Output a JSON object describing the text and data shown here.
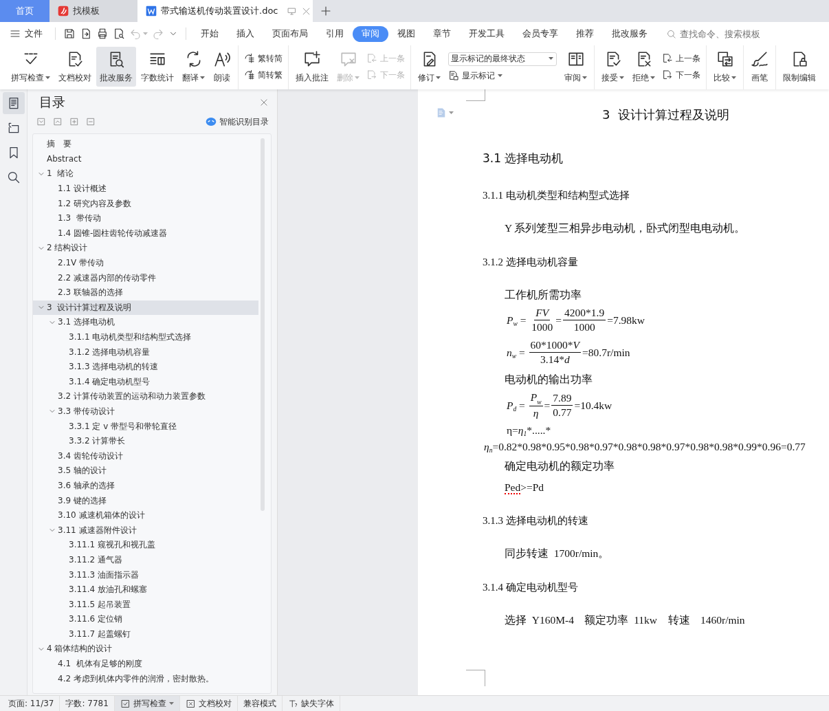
{
  "tabs": [
    {
      "label": "首页",
      "kind": "home",
      "selected": false
    },
    {
      "label": "找模板",
      "kind": "template",
      "selected": false
    },
    {
      "label": "带式输送机传动装置设计.doc",
      "kind": "document",
      "selected": true
    }
  ],
  "menu": {
    "file": "文件"
  },
  "quick_tools": [
    {
      "disabled": false,
      "dropdown": false
    },
    {
      "disabled": false,
      "dropdown": false
    },
    {
      "disabled": false,
      "dropdown": false
    },
    {
      "disabled": false,
      "dropdown": false
    },
    {
      "disabled": true,
      "dropdown": true
    },
    {
      "disabled": true,
      "dropdown": false
    }
  ],
  "ribbon_tabs": [
    {
      "label": "开始",
      "selected": false
    },
    {
      "label": "插入",
      "selected": false
    },
    {
      "label": "页面布局",
      "selected": false
    },
    {
      "label": "引用",
      "selected": false
    },
    {
      "label": "审阅",
      "selected": true
    },
    {
      "label": "视图",
      "selected": false
    },
    {
      "label": "章节",
      "selected": false
    },
    {
      "label": "开发工具",
      "selected": false
    },
    {
      "label": "会员专享",
      "selected": false
    },
    {
      "label": "推荐",
      "selected": false
    },
    {
      "label": "批改服务",
      "selected": false
    }
  ],
  "search": {
    "placeholder": "查找命令、搜索模板"
  },
  "ribbon": {
    "groups": [
      {
        "items": [
          {
            "kind": "large",
            "label": "拼写检查",
            "dropdown": true,
            "disabled": false,
            "selected": false
          },
          {
            "kind": "large",
            "label": "文档校对",
            "dropdown": false,
            "disabled": false,
            "selected": false
          },
          {
            "kind": "large",
            "label": "批改服务",
            "dropdown": false,
            "disabled": false,
            "selected": true
          },
          {
            "kind": "large",
            "label": "字数统计",
            "dropdown": false,
            "disabled": false,
            "selected": false
          },
          {
            "kind": "large",
            "label": "翻译",
            "dropdown": true,
            "disabled": false,
            "selected": false
          },
          {
            "kind": "large",
            "label": "朗读",
            "dropdown": false,
            "disabled": false,
            "selected": false
          }
        ]
      },
      {
        "items": [
          {
            "kind": "stack",
            "buttons": [
              {
                "label": "繁转简",
                "disabled": false
              },
              {
                "label": "简转繁",
                "disabled": false
              }
            ]
          }
        ]
      },
      {
        "items": [
          {
            "kind": "large",
            "label": "插入批注",
            "dropdown": false,
            "disabled": false,
            "selected": false
          },
          {
            "kind": "large",
            "label": "删除",
            "dropdown": true,
            "disabled": true,
            "selected": false
          },
          {
            "kind": "stack",
            "buttons": [
              {
                "label": "上一条",
                "disabled": true
              },
              {
                "label": "下一条",
                "disabled": true
              }
            ]
          }
        ]
      },
      {
        "items": [
          {
            "kind": "large",
            "label": "修订",
            "dropdown": true,
            "disabled": false,
            "selected": false
          },
          {
            "kind": "select",
            "value": "显示标记的最终状态",
            "button": {
              "label": "显示标记",
              "dropdown": true
            }
          },
          {
            "kind": "large",
            "label": "审阅",
            "dropdown": true,
            "disabled": false,
            "selected": false
          }
        ]
      },
      {
        "items": [
          {
            "kind": "large",
            "label": "接受",
            "dropdown": true,
            "disabled": false,
            "selected": false
          },
          {
            "kind": "large",
            "label": "拒绝",
            "dropdown": true,
            "disabled": false,
            "selected": false
          },
          {
            "kind": "stack",
            "buttons": [
              {
                "label": "上一条",
                "disabled": false
              },
              {
                "label": "下一条",
                "disabled": false
              }
            ]
          }
        ]
      },
      {
        "items": [
          {
            "kind": "large",
            "label": "比较",
            "dropdown": true,
            "disabled": false,
            "selected": false
          }
        ]
      },
      {
        "items": [
          {
            "kind": "large",
            "label": "画笔",
            "dropdown": false,
            "disabled": false,
            "selected": false
          }
        ]
      },
      {
        "items": [
          {
            "kind": "large",
            "label": "限制编辑",
            "dropdown": false,
            "disabled": false,
            "selected": false
          }
        ]
      }
    ]
  },
  "sidebar_tabs": [
    {
      "selected": true
    },
    {
      "selected": false
    },
    {
      "selected": false
    },
    {
      "selected": false
    }
  ],
  "outline": {
    "title": "目录",
    "smart_button": "智能识别目录",
    "items": [
      {
        "label": "摘　要",
        "selected": false
      },
      {
        "label": "Abstract",
        "selected": false
      },
      {
        "label": "1  绪论",
        "selected": false,
        "expanded": true,
        "children": [
          {
            "label": "1.1 设计概述",
            "selected": false
          },
          {
            "label": "1.2 研究内容及参数",
            "selected": false
          },
          {
            "label": "1.3  带传动",
            "selected": false
          },
          {
            "label": "1.4 圆锥-圆柱齿轮传动减速器",
            "selected": false
          }
        ]
      },
      {
        "label": "2 结构设计",
        "selected": false,
        "expanded": true,
        "children": [
          {
            "label": "2.1V 带传动",
            "selected": false
          },
          {
            "label": "2.2 减速器内部的传动零件",
            "selected": false
          },
          {
            "label": "2.3 联轴器的选择",
            "selected": false
          }
        ]
      },
      {
        "label": "3  设计计算过程及说明",
        "selected": true,
        "expanded": true,
        "children": [
          {
            "label": "3.1 选择电动机",
            "selected": false,
            "expanded": true,
            "children": [
              {
                "label": "3.1.1 电动机类型和结构型式选择",
                "selected": false
              },
              {
                "label": "3.1.2 选择电动机容量",
                "selected": false
              },
              {
                "label": "3.1.3 选择电动机的转速",
                "selected": false
              },
              {
                "label": "3.1.4 确定电动机型号",
                "selected": false
              }
            ]
          },
          {
            "label": "3.2 计算传动装置的运动和动力装置参数",
            "selected": false
          },
          {
            "label": "3.3 带传动设计",
            "selected": false,
            "expanded": true,
            "children": [
              {
                "label": "3.3.1 定 v 带型号和带轮直径",
                "selected": false
              },
              {
                "label": "3.3.2 计算带长",
                "selected": false
              }
            ]
          },
          {
            "label": "3.4 齿轮传动设计",
            "selected": false
          },
          {
            "label": "3.5 轴的设计",
            "selected": false
          },
          {
            "label": "3.6 轴承的选择",
            "selected": false
          },
          {
            "label": "3.9 键的选择",
            "selected": false
          },
          {
            "label": "3.10 减速机箱体的设计",
            "selected": false
          },
          {
            "label": "3.11 减速器附件设计",
            "selected": false,
            "expanded": true,
            "children": [
              {
                "label": "3.11.1 窥视孔和视孔盖",
                "selected": false
              },
              {
                "label": "3.11.2 通气器",
                "selected": false
              },
              {
                "label": "3.11.3 油面指示器",
                "selected": false
              },
              {
                "label": "3.11.4 放油孔和螺塞",
                "selected": false
              },
              {
                "label": "3.11.5 起吊装置",
                "selected": false
              },
              {
                "label": "3.11.6 定位销",
                "selected": false
              },
              {
                "label": "3.11.7 起盖螺钉",
                "selected": false
              }
            ]
          }
        ]
      },
      {
        "label": "4 箱体结构的设计",
        "selected": false,
        "expanded": true,
        "children": [
          {
            "label": "4.1  机体有足够的刚度",
            "selected": false
          },
          {
            "label": "4.2 考虑到机体内零件的润滑，密封散热。",
            "selected": false
          }
        ]
      }
    ]
  },
  "document": {
    "blocks": [
      {
        "kind": "title",
        "text": "3  设计计算过程及说明"
      },
      {
        "kind": "h2",
        "text": "3.1 选择电动机"
      },
      {
        "kind": "h3",
        "text": "3.1.1 电动机类型和结构型式选择"
      },
      {
        "kind": "para",
        "text": "Y 系列笼型三相异步电动机，卧式闭型电电动机。"
      },
      {
        "kind": "h3",
        "text": "3.1.2 选择电动机容量"
      },
      {
        "kind": "para",
        "text": "工作机所需功率"
      },
      {
        "kind": "formula",
        "indented": true,
        "parts": [
          {
            "kind": "sym",
            "text": "P",
            "sub": "w"
          },
          {
            "kind": "text",
            "text": " = "
          },
          {
            "kind": "frac",
            "num": [
              {
                "kind": "text",
                "text": "FV",
                "italic": true
              }
            ],
            "den": [
              {
                "kind": "text",
                "text": "1000",
                "italic": false
              }
            ]
          },
          {
            "kind": "text",
            "text": "="
          },
          {
            "kind": "frac",
            "num": [
              {
                "kind": "text",
                "text": "4200*1.9",
                "italic": false
              }
            ],
            "den": [
              {
                "kind": "text",
                "text": "1000",
                "italic": false
              }
            ]
          },
          {
            "kind": "text",
            "text": "=7.98kw"
          }
        ]
      },
      {
        "kind": "formula",
        "indented": true,
        "parts": [
          {
            "kind": "sym",
            "text": "n",
            "sub": "w"
          },
          {
            "kind": "text",
            "text": " = "
          },
          {
            "kind": "frac",
            "num": [
              {
                "kind": "text",
                "text": "60*1000*",
                "italic": false
              },
              {
                "kind": "text",
                "text": "V",
                "italic": true
              }
            ],
            "den": [
              {
                "kind": "text",
                "text": "3.14*",
                "italic": false
              },
              {
                "kind": "text",
                "text": "d",
                "italic": true
              }
            ]
          },
          {
            "kind": "text",
            "text": "=80.7r/min"
          }
        ]
      },
      {
        "kind": "para",
        "text": "电动机的输出功率"
      },
      {
        "kind": "formula",
        "indented": true,
        "parts": [
          {
            "kind": "sym",
            "text": "P",
            "sub": "d"
          },
          {
            "kind": "text",
            "text": " = "
          },
          {
            "kind": "frac",
            "num": [
              {
                "kind": "sym",
                "text": "P",
                "sub": "w"
              }
            ],
            "den": [
              {
                "kind": "text",
                "text": "η",
                "italic": true
              }
            ]
          },
          {
            "kind": "text",
            "text": "="
          },
          {
            "kind": "frac",
            "num": [
              {
                "kind": "text",
                "text": "7.89",
                "italic": false
              }
            ],
            "den": [
              {
                "kind": "text",
                "text": "0.77",
                "italic": false
              }
            ]
          },
          {
            "kind": "text",
            "text": "=10.4kw"
          }
        ]
      },
      {
        "kind": "formula",
        "indented": true,
        "parts": [
          {
            "kind": "text",
            "text": "η="
          },
          {
            "kind": "sym",
            "text": "η",
            "sub": "1"
          },
          {
            "kind": "text",
            "text": "*.....*"
          }
        ]
      },
      {
        "kind": "formula",
        "indented": false,
        "parts": [
          {
            "kind": "sym",
            "text": "η",
            "sub": "n"
          },
          {
            "kind": "text",
            "text": "=0.82*0.98*0.95*0.98*0.97*0.98*0.98*0.97*0.98*0.98*0.99*0.96=0.77"
          }
        ]
      },
      {
        "kind": "para",
        "text": "确定电动机的额定功率"
      },
      {
        "kind": "segments",
        "segments": [
          {
            "text": "Ped",
            "misspelled": true
          },
          {
            "text": ">=Pd",
            "misspelled": false
          }
        ]
      },
      {
        "kind": "h3",
        "text": "3.1.3 选择电动机的转速"
      },
      {
        "kind": "para",
        "text": "同步转速  1700r/min。"
      },
      {
        "kind": "h3",
        "text": "3.1.4 确定电动机型号"
      },
      {
        "kind": "para",
        "text": "选择  Y160M-4    额定功率  11kw    转速    1460r/min"
      }
    ]
  },
  "status_bar": {
    "items": [
      {
        "kind": "text",
        "text": "页面: 11/37"
      },
      {
        "kind": "text",
        "text": "字数: 7781"
      },
      {
        "kind": "toggle",
        "text": "拼写检查",
        "on": true
      },
      {
        "kind": "button",
        "text": "文档校对"
      },
      {
        "kind": "text",
        "text": "兼容模式"
      },
      {
        "kind": "button",
        "text": "缺失字体"
      }
    ]
  }
}
